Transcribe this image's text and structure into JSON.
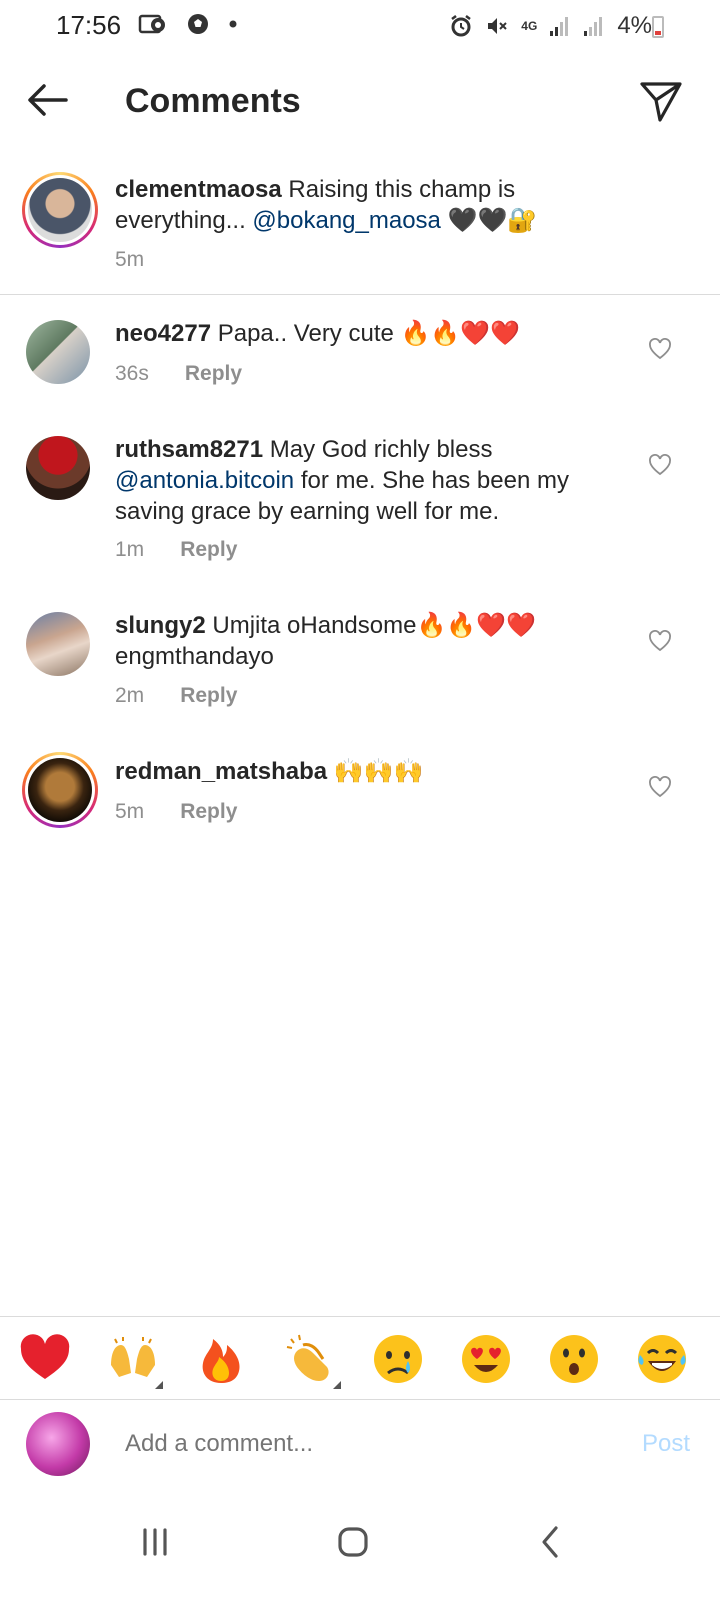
{
  "status_bar": {
    "time": "17:56",
    "battery": "4%",
    "network": "4G"
  },
  "header": {
    "title": "Comments"
  },
  "caption": {
    "username": "clementmaosa",
    "text_before": " Raising this champ is everything... ",
    "mention": "@bokang_maosa",
    "emoji": " 🖤🖤🔐",
    "time": "5m"
  },
  "comments": [
    {
      "username": "neo4277",
      "text_before": " Papa.. Very cute ",
      "mention": "",
      "text_after": "🔥🔥❤️❤️",
      "time": "36s",
      "reply": "Reply"
    },
    {
      "username": "ruthsam8271",
      "text_before": " May God richly bless ",
      "mention": "@antonia.bitcoin",
      "text_after": " for me. She has been my saving grace by earning well for me.",
      "time": "1m",
      "reply": "Reply"
    },
    {
      "username": "slungy2",
      "text_before": " Umjita oHandsome🔥🔥❤️❤️ engmthandayo",
      "mention": "",
      "text_after": "",
      "time": "2m",
      "reply": "Reply"
    },
    {
      "username": "redman_matshaba",
      "text_before": " 🙌🙌🙌",
      "mention": "",
      "text_after": "",
      "time": "5m",
      "reply": "Reply"
    }
  ],
  "reactions": [
    "heart-emoji",
    "raising-hands-emoji",
    "fire-emoji",
    "clapping-hands-emoji",
    "crying-face-emoji",
    "heart-eyes-emoji",
    "surprised-face-emoji",
    "tears-of-joy-emoji"
  ],
  "composer": {
    "placeholder": "Add a comment...",
    "post_label": "Post"
  },
  "colors": {
    "mention": "#00376b",
    "muted": "#8e8e8e",
    "post_disabled": "#b3dbff",
    "divider": "#dbdbdb"
  }
}
